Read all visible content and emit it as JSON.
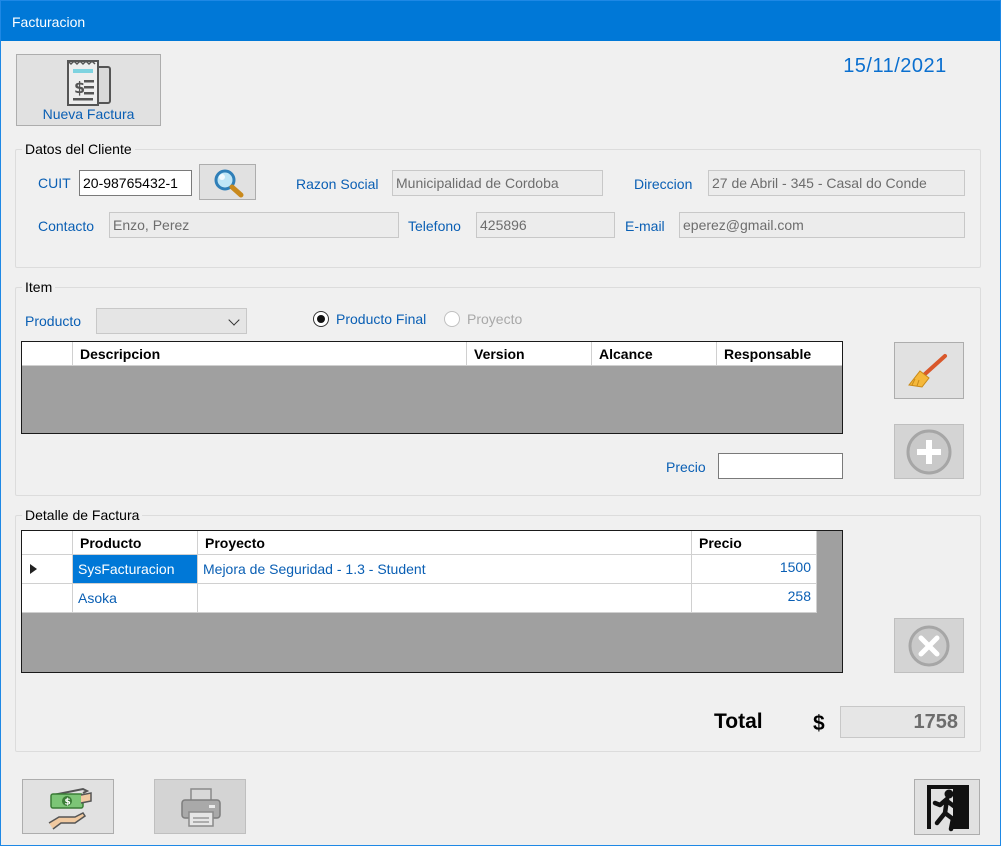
{
  "window": {
    "title": "Facturacion"
  },
  "header": {
    "new_invoice_label": "Nueva Factura",
    "date": "15/11/2021"
  },
  "client": {
    "group_title": "Datos del Cliente",
    "cuit_label": "CUIT",
    "cuit_value": "20-98765432-1",
    "razon_label": "Razon Social",
    "razon_value": "Municipalidad de Cordoba",
    "direccion_label": "Direccion",
    "direccion_value": "27 de Abril - 345 - Casal do Conde",
    "contacto_label": "Contacto",
    "contacto_value": "Enzo, Perez",
    "telefono_label": "Telefono",
    "telefono_value": "425896",
    "email_label": "E-mail",
    "email_value": "eperez@gmail.com"
  },
  "item": {
    "group_title": "Item",
    "producto_label": "Producto",
    "producto_value": "",
    "radio_final": "Producto Final",
    "radio_proyecto": "Proyecto",
    "columns": [
      "Descripcion",
      "Version",
      "Alcance",
      "Responsable"
    ],
    "precio_label": "Precio",
    "precio_value": ""
  },
  "detail": {
    "group_title": "Detalle de Factura",
    "columns": [
      "Producto",
      "Proyecto",
      "Precio"
    ],
    "rows": [
      {
        "producto": "SysFacturacion",
        "proyecto": "Mejora de Seguridad - 1.3 - Student",
        "precio": "1500"
      },
      {
        "producto": "Asoka",
        "proyecto": "",
        "precio": "258"
      }
    ]
  },
  "totals": {
    "label": "Total",
    "currency": "$",
    "value": "1758"
  },
  "icons": {
    "new_invoice": "receipt-icon",
    "search": "magnifier-icon",
    "clear": "broom-icon",
    "add": "plus-circle-icon",
    "remove": "x-circle-icon",
    "pay": "cash-payment-icon",
    "print": "printer-icon",
    "exit": "exit-running-man-icon"
  },
  "colors": {
    "titlebar": "#0078d7",
    "label": "#0a5fb4",
    "selection": "#0078d7"
  }
}
